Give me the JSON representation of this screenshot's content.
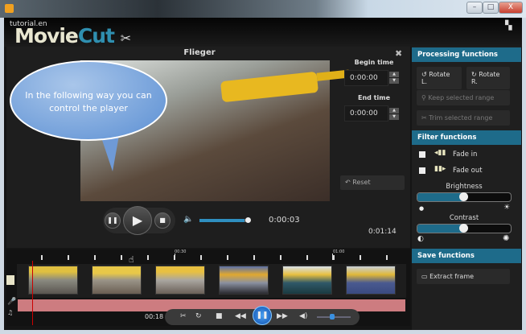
{
  "app": {
    "brand_prefix": "tutorial.en",
    "brand_main": "Movie",
    "brand_accent": "Cut"
  },
  "window": {
    "minimize": "–",
    "maximize": "□",
    "close": "X"
  },
  "player": {
    "title": "Flieger",
    "tooltip": "In the following way you can control the player",
    "current_time": "0:00:03",
    "duration": "0:01:14",
    "volume_percent": 90
  },
  "range": {
    "begin_label": "Begin time",
    "begin_value": "0:00:00",
    "end_label": "End time",
    "end_value": "0:00:00",
    "reset": "Reset"
  },
  "processing": {
    "title": "Processing functions",
    "rotate_left": "Rotate L.",
    "rotate_right": "Rotate R.",
    "keep_range": "Keep selected range",
    "trim_range": "Trim selected range"
  },
  "filter": {
    "title": "Filter functions",
    "fade_in": "Fade in",
    "fade_out": "Fade out",
    "brightness": "Brightness",
    "brightness_value": 0.5,
    "contrast": "Contrast",
    "contrast_value": 0.5
  },
  "save": {
    "title": "Save functions",
    "extract_frame": "Extract frame"
  },
  "timeline": {
    "marks": [
      "00:30",
      "01:00"
    ],
    "position": "00:18",
    "thumb_count": 6
  },
  "colors": {
    "accent": "#1e6b8a",
    "audio_track": "#cd7c80"
  }
}
